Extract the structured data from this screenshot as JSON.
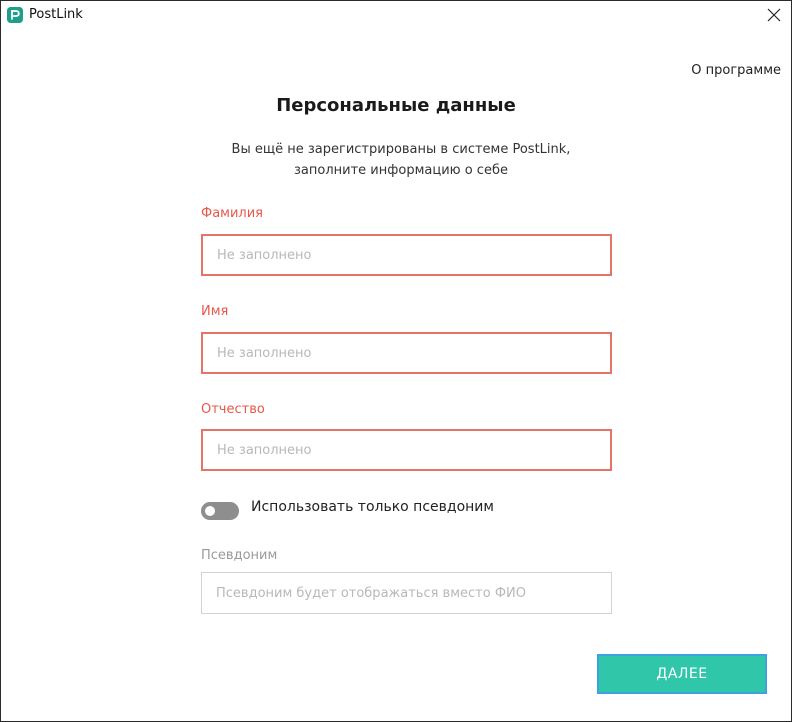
{
  "window": {
    "title": "PostLink"
  },
  "header": {
    "about_link": "О программе",
    "page_title": "Персональные данные",
    "subtitle_line1": "Вы ещё не зарегистрированы в системе PostLink,",
    "subtitle_line2": "заполните информацию о себе"
  },
  "form": {
    "last_name": {
      "label": "Фамилия",
      "placeholder": "Не заполнено",
      "value": ""
    },
    "first_name": {
      "label": "Имя",
      "placeholder": "Не заполнено",
      "value": ""
    },
    "middle_name": {
      "label": "Отчество",
      "placeholder": "Не заполнено",
      "value": ""
    },
    "pseudonym_toggle": {
      "label": "Использовать только псевдоним",
      "enabled": false
    },
    "pseudonym": {
      "label": "Псевдоним",
      "placeholder": "Псевдоним будет отображаться вместо ФИО",
      "value": ""
    }
  },
  "actions": {
    "next_label": "ДАЛЕЕ"
  },
  "colors": {
    "accent": "#2fc6aa",
    "error": "#e8574a",
    "app_icon": "#1f9e8a"
  },
  "icons": {
    "app": "postlink-logo-icon",
    "close": "close-icon"
  }
}
